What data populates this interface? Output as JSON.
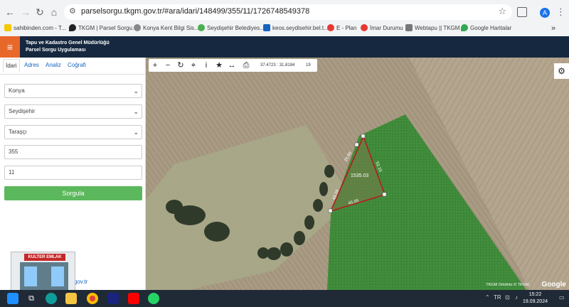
{
  "browser": {
    "url": "parselsorgu.tkgm.gov.tr/#ara/idari/148499/355/11/1726748549378",
    "profile_initial": "A",
    "bookmarks": [
      {
        "label": "sahibinden.com - T...",
        "icon": "sahibinden-icon",
        "color": "#f6c800"
      },
      {
        "label": "TKGM | Parsel Sorgu...",
        "icon": "map-pin-icon",
        "color": "#222222"
      },
      {
        "label": "Konya Kent Bilgi Sis...",
        "icon": "globe-icon",
        "color": "#888888"
      },
      {
        "label": "Seydişehir Belediyes...",
        "icon": "municipality-icon",
        "color": "#4caf50"
      },
      {
        "label": "keos.seydisehir.bel.t...",
        "icon": "doc-icon",
        "color": "#1565c0"
      },
      {
        "label": "E - Plan",
        "icon": "eplan-icon",
        "color": "#e53935"
      },
      {
        "label": "İmar Durumu",
        "icon": "imar-icon",
        "color": "#e53935"
      },
      {
        "label": "Webtapu || TKGM",
        "icon": "webtapu-icon",
        "color": "#777777"
      },
      {
        "label": "Google Haritalar",
        "icon": "google-maps-icon",
        "color": "#34a853"
      }
    ]
  },
  "app": {
    "title_line1": "Tapu ve Kadastro Genel Müdürlüğü",
    "title_line2": "Parsel Sorgu Uygulaması",
    "accent": "#e8682a",
    "header_bg": "#15283f"
  },
  "panel": {
    "tabs": [
      "İdari",
      "Adres",
      "Analiz",
      "Coğrafi"
    ],
    "active_tab": "İdari",
    "fields": {
      "il": "Konya",
      "ilce": "Seydişehir",
      "mahalle": "Taraşçı",
      "ada": "355",
      "parsel": "11"
    },
    "submit_label": "Sorgula",
    "submit_color": "#5cb85c",
    "footer_link": "m.gov.tr"
  },
  "overlay_sign": "KULTER EMLAK",
  "map": {
    "coords": "37.4723 : 31.8184",
    "zoom": "19",
    "attribution": "TKGM Ortofoto © TKGM,",
    "provider_logo": "Google",
    "parcel_area": "1535.03",
    "edge_labels": [
      "25.90",
      "52.15",
      "45.05",
      "43.19"
    ]
  },
  "taskbar": {
    "time": "15:22",
    "date": "19.09.2024",
    "lang": "TR"
  }
}
